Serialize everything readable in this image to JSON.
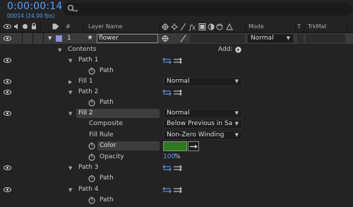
{
  "header": {
    "timecode": "0:00:00:14",
    "frames": "00014 (24.00 fps)",
    "search_placeholder": ""
  },
  "columns": {
    "hash": "#",
    "layer_name": "Layer Name",
    "mode": "Mode",
    "t": "T",
    "trkmat": "TrkMat"
  },
  "layer": {
    "number": "1",
    "name": "flower",
    "mode": "Normal"
  },
  "tree": {
    "contents": "Contents",
    "add_label": "Add:",
    "path1": "Path 1",
    "path1_path": "Path",
    "fill1": "Fill 1",
    "fill1_mode": "Normal",
    "path2": "Path 2",
    "path2_path": "Path",
    "fill2": "Fill 2",
    "fill2_mode": "Normal",
    "composite": "Composite",
    "composite_value": "Below Previous in Sa",
    "fill_rule": "Fill Rule",
    "fill_rule_value": "Non-Zero Winding",
    "color": "Color",
    "color_value": "#2e7a1c",
    "opacity": "Opacity",
    "opacity_value": "100",
    "opacity_unit": "%",
    "path3": "Path 3",
    "path3_path": "Path",
    "path4": "Path 4",
    "path4_path": "Path"
  },
  "colors": {
    "accent": "#5d9cf2",
    "label_swatch": "#8f8fe0",
    "background": "#232323"
  }
}
